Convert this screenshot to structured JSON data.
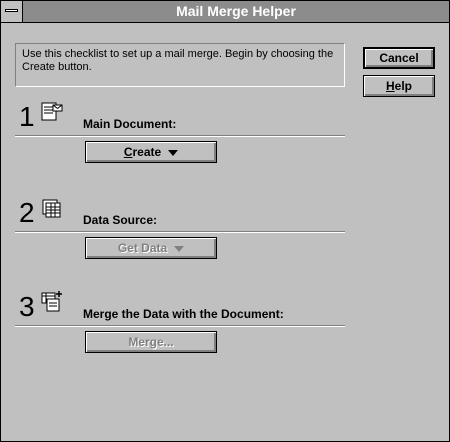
{
  "window": {
    "title": "Mail Merge Helper"
  },
  "info": {
    "text": "Use this checklist to set up a mail merge. Begin by choosing the Create button."
  },
  "buttons": {
    "cancel": "Cancel",
    "help_key": "H",
    "help_rest": "elp"
  },
  "steps": [
    {
      "number": "1",
      "label": "Main Document:",
      "button_key": "C",
      "button_rest": "reate",
      "enabled": true,
      "icon": "main-document-icon"
    },
    {
      "number": "2",
      "label": "Data Source:",
      "button": "Get Data",
      "enabled": false,
      "icon": "data-source-icon"
    },
    {
      "number": "3",
      "label": "Merge the Data with the Document:",
      "button": "Merge...",
      "enabled": false,
      "icon": "merge-icon"
    }
  ]
}
